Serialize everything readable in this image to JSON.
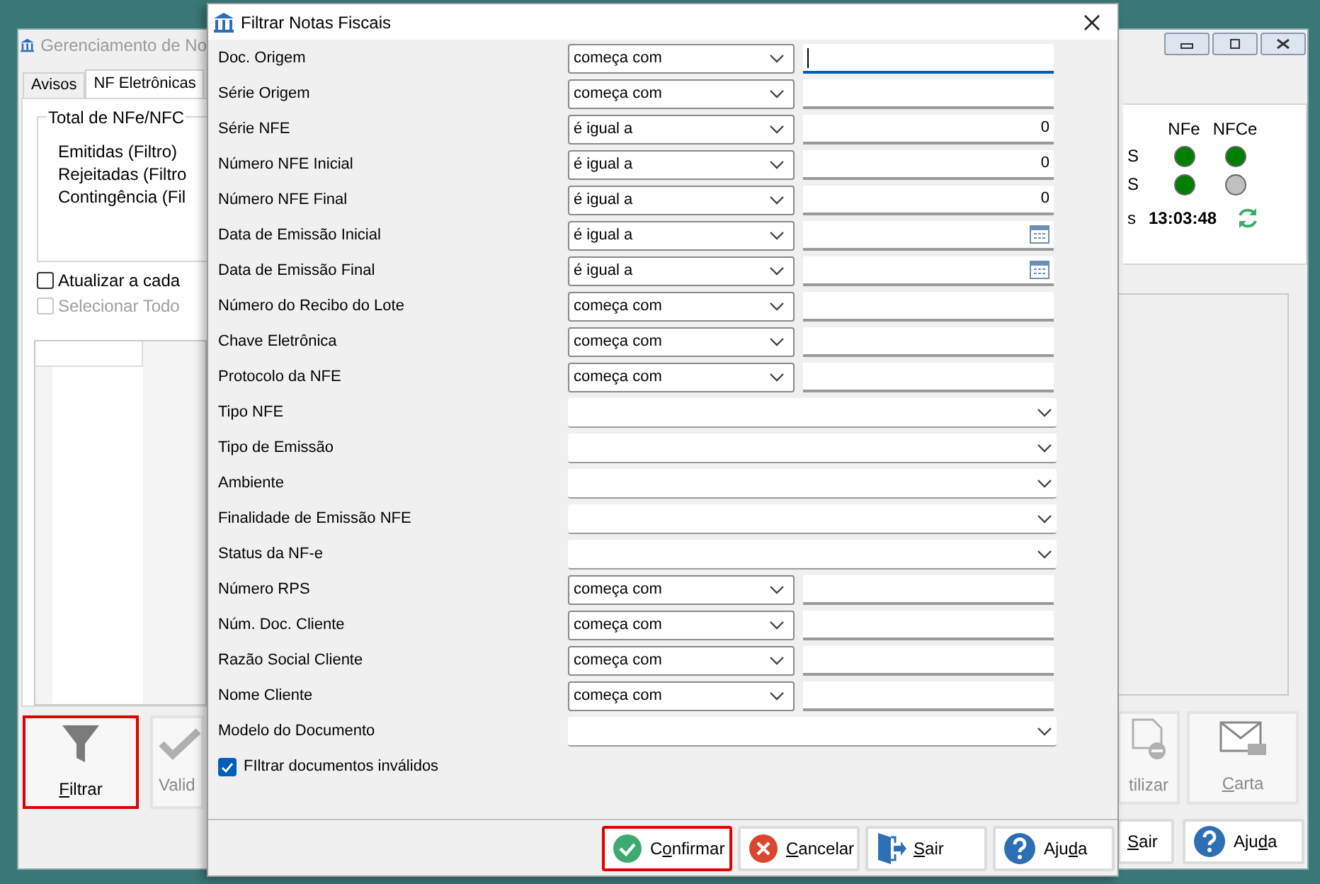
{
  "main_window": {
    "title": "Gerenciamento de No",
    "tabs": [
      {
        "label": "Avisos",
        "selected": false
      },
      {
        "label": "NF Eletrônicas",
        "selected": true
      }
    ],
    "totals_group": {
      "title": "Total de NFe/NFC",
      "lines": [
        "Emitidas (Filtro)",
        "Rejeitadas (Filtro",
        "Contingência (Fil"
      ]
    },
    "options": [
      {
        "label": "Atualizar a cada",
        "checked": false,
        "disabled": false
      },
      {
        "label": "Selecionar Todo",
        "checked": false,
        "disabled": true
      }
    ],
    "status": {
      "columns": [
        "NFe",
        "NFCe"
      ],
      "rows": [
        {
          "label": "S",
          "lights": [
            {
              "color": "#008000"
            },
            {
              "color": "#008000"
            }
          ]
        },
        {
          "label": "S",
          "lights": [
            {
              "color": "#008000"
            },
            {
              "color": "#c0c0c0"
            }
          ]
        }
      ],
      "time_label": "s",
      "time": "13:03:48"
    },
    "toolbar_left": [
      {
        "label": "Filtrar",
        "disabled": false,
        "highlighted": true
      },
      {
        "label": "Valid",
        "disabled": true,
        "highlighted": false
      }
    ],
    "toolbar_right": [
      {
        "label": "tilizar",
        "disabled": true,
        "highlighted": false
      },
      {
        "label": "Carta",
        "disabled": true,
        "highlighted": false
      }
    ],
    "footer_buttons": [
      {
        "label": "Sair",
        "highlighted": false
      },
      {
        "label": "Ajuda",
        "highlighted": false
      }
    ]
  },
  "dialog": {
    "title": "Filtrar Notas Fiscais",
    "fields": [
      {
        "kind": "text",
        "label": "Doc. Origem",
        "operator": "começa com",
        "focused": true
      },
      {
        "kind": "text",
        "label": "Série Origem",
        "operator": "começa com",
        "focused": false
      },
      {
        "kind": "text",
        "label": "Série NFE",
        "operator": "é igual a",
        "value": "0",
        "focused": false
      },
      {
        "kind": "text",
        "label": "Número NFE Inicial",
        "operator": "é igual a",
        "value": "0",
        "focused": false
      },
      {
        "kind": "text",
        "label": "Número NFE Final",
        "operator": "é igual a",
        "value": "0",
        "focused": false
      },
      {
        "kind": "date",
        "label": "Data de Emissão Inicial",
        "operator": "é igual a",
        "focused": false
      },
      {
        "kind": "date",
        "label": "Data de Emissão Final",
        "operator": "é igual a",
        "focused": false
      },
      {
        "kind": "text",
        "label": "Número do Recibo do Lote",
        "operator": "começa com",
        "focused": false
      },
      {
        "kind": "text",
        "label": "Chave Eletrônica",
        "operator": "começa com",
        "focused": false
      },
      {
        "kind": "text",
        "label": "Protocolo da NFE",
        "operator": "começa com",
        "focused": false
      },
      {
        "kind": "dropdown",
        "label": "Tipo NFE"
      },
      {
        "kind": "dropdown",
        "label": "Tipo de Emissão"
      },
      {
        "kind": "dropdown",
        "label": "Ambiente"
      },
      {
        "kind": "dropdown",
        "label": "Finalidade de Emissão NFE"
      },
      {
        "kind": "dropdown",
        "label": "Status da NF-e"
      },
      {
        "kind": "text",
        "label": "Número RPS",
        "operator": "começa com",
        "focused": false
      },
      {
        "kind": "text",
        "label": "Núm. Doc. Cliente",
        "operator": "começa com",
        "focused": false
      },
      {
        "kind": "text",
        "label": "Razão Social Cliente",
        "operator": "começa com",
        "focused": false
      },
      {
        "kind": "text",
        "label": "Nome Cliente",
        "operator": "começa com",
        "focused": false
      },
      {
        "kind": "dropdown",
        "label": "Modelo do Documento"
      }
    ],
    "checkbox": {
      "label": "FIltrar documentos inválidos",
      "checked": true
    },
    "buttons": [
      {
        "label": "Confirmar",
        "highlighted": true
      },
      {
        "label": "Cancelar",
        "highlighted": false
      },
      {
        "label": "Sair",
        "highlighted": false
      },
      {
        "label": "Ajuda",
        "highlighted": false
      }
    ]
  }
}
